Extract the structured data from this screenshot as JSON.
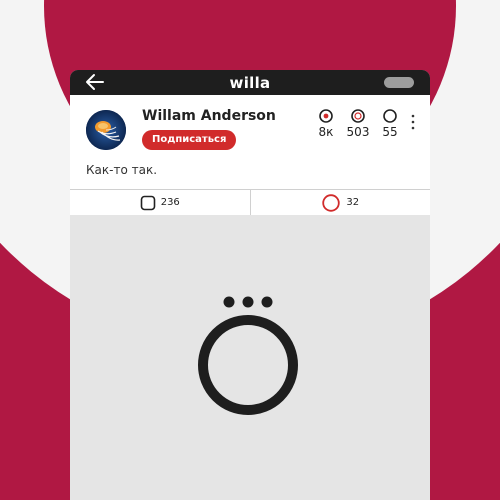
{
  "header": {
    "title": "willa",
    "back_icon": "arrow-left-icon",
    "colors": {
      "bar": "#1e1e1e",
      "page_accent": "#b01843"
    }
  },
  "profile": {
    "name": "Willam Anderson",
    "subscribe_label": "Подписаться",
    "stats": [
      {
        "icon": "target-icon",
        "value": "8к"
      },
      {
        "icon": "double-ring-icon",
        "value": "503"
      },
      {
        "icon": "ring-icon",
        "value": "55"
      }
    ]
  },
  "post": {
    "text": "Как-то так.",
    "comments_count": "236",
    "likes_count": "32"
  }
}
